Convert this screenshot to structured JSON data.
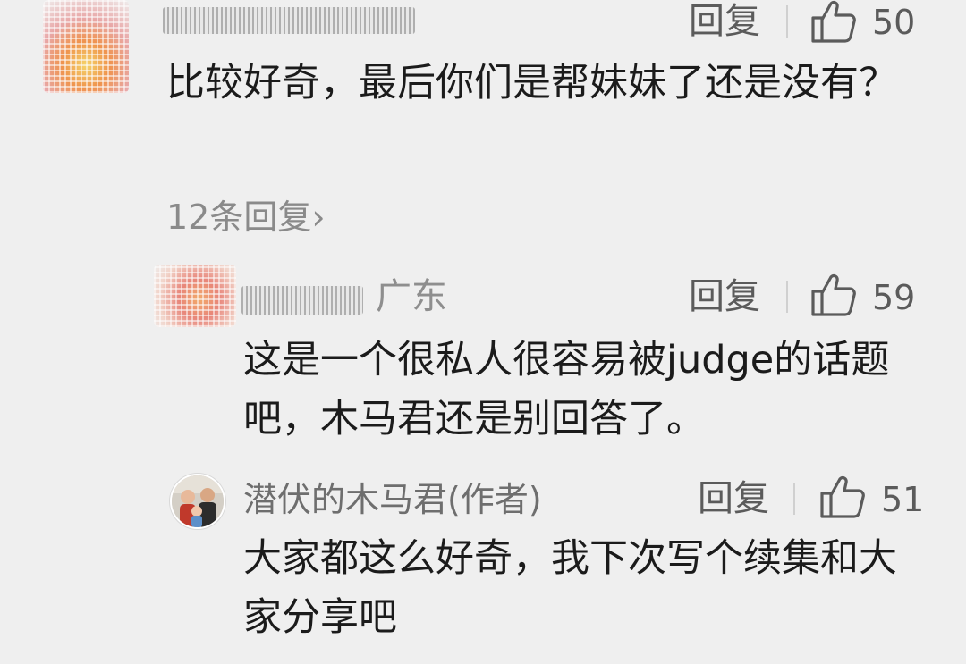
{
  "reply_label": "回复",
  "comments": [
    {
      "body": "比较好奇，最后你们是帮妹妹了还是没有？",
      "likes": "50",
      "replies_link": "12条回复"
    },
    {
      "location": "广东",
      "body": "这是一个很私人很容易被judge的话题吧，木马君还是别回答了。",
      "likes": "59"
    },
    {
      "author": "潜伏的木马君(作者)",
      "body": "大家都这么好奇，我下次写个续集和大家分享吧",
      "likes": "51"
    }
  ],
  "icons": {
    "like": "thumbs-up-outline-icon",
    "chevron": "chevron-right-icon"
  },
  "colors": {
    "background": "#efefef",
    "text": "#1b1b1b",
    "muted": "#7d7d7d"
  }
}
